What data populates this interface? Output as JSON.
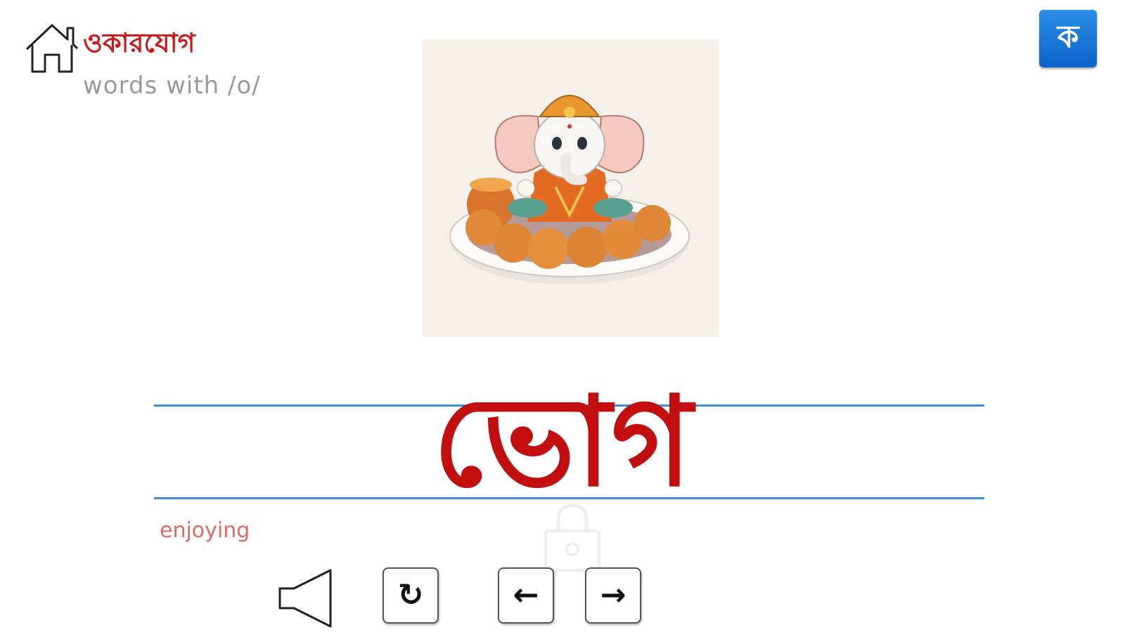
{
  "header": {
    "lesson_title": "ওকারযোগ",
    "lesson_subtitle": "words with /o/",
    "script_toggle_label": "ক"
  },
  "card": {
    "word": "ভোগ",
    "meaning": "enjoying"
  },
  "controls": {
    "undo_glyph": "↻",
    "prev_glyph": "←",
    "next_glyph": "→"
  },
  "colors": {
    "accent_red": "#c20e0e",
    "guide_line_blue": "#3a8fd8",
    "script_button_blue": "#0b63c9"
  }
}
